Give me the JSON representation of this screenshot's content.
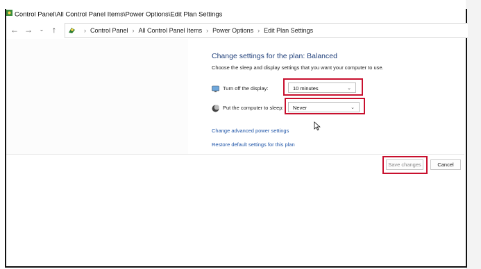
{
  "window": {
    "title": "Control Panel\\All Control Panel Items\\Power Options\\Edit Plan Settings"
  },
  "nav": {
    "back_icon": "arrow-left-icon",
    "forward_icon": "arrow-right-icon",
    "recent_icon": "chevron-down-icon",
    "up_icon": "arrow-up-icon",
    "breadcrumbs": [
      "Control Panel",
      "All Control Panel Items",
      "Power Options",
      "Edit Plan Settings"
    ],
    "separator": "›"
  },
  "main": {
    "heading": "Change settings for the plan: Balanced",
    "subheading": "Choose the sleep and display settings that you want your computer to use.",
    "display": {
      "label": "Turn off the display:",
      "value": "10 minutes",
      "icon": "monitor-icon"
    },
    "sleep": {
      "label": "Put the computer to sleep:",
      "value": "Never",
      "icon": "moon-icon"
    },
    "links": {
      "advanced": "Change advanced power settings",
      "restore": "Restore default settings for this plan"
    }
  },
  "footer": {
    "save_label": "Save changes",
    "cancel_label": "Cancel"
  },
  "colors": {
    "highlight": "#c8102e",
    "heading": "#1f3f7a",
    "link": "#1f55a8"
  }
}
